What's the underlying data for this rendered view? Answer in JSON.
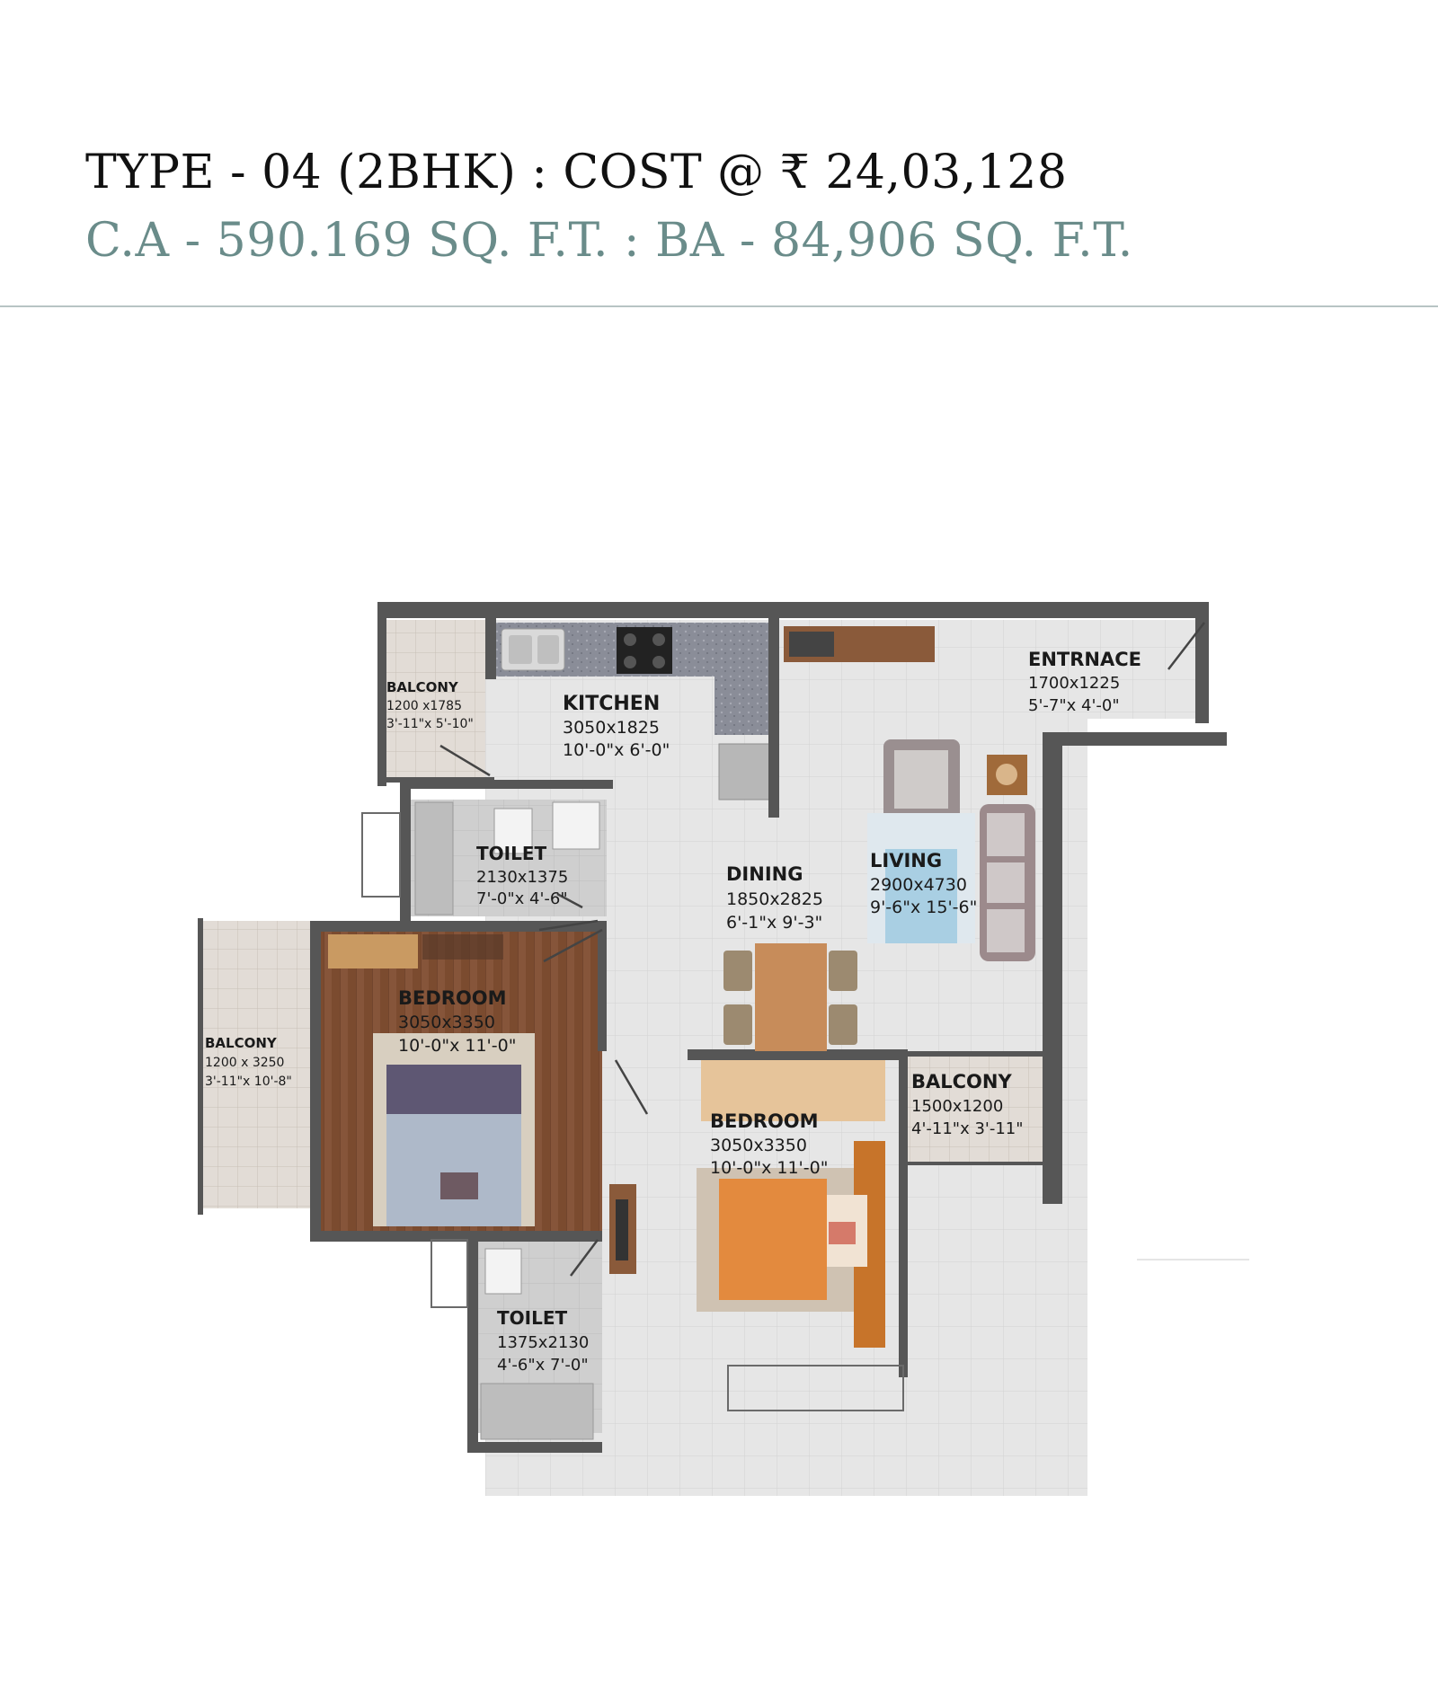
{
  "header": {
    "title": "TYPE - 04 (2BHK) : COST @ ₹ 24,03,128",
    "subtitle": "C.A - 590.169 SQ. F.T. : BA - 84,906 SQ. F.T."
  },
  "colors": {
    "title": "#111111",
    "subtitle": "#6a8c8a",
    "wall": "#555555",
    "floor_tile": "#e4e4e4",
    "wood_floor": "#7a4a2e"
  },
  "rooms": {
    "balcony_kitchen": {
      "name": "BALCONY",
      "dim1": "1200 x1785",
      "dim2": "3'-11\"x 5'-10\""
    },
    "kitchen": {
      "name": "KITCHEN",
      "dim1": "3050x1825",
      "dim2": "10'-0\"x 6'-0\""
    },
    "entrance": {
      "name": "ENTRNACE",
      "dim1": "1700x1225",
      "dim2": "5'-7\"x 4'-0\""
    },
    "toilet_top": {
      "name": "TOILET",
      "dim1": "2130x1375",
      "dim2": "7'-0\"x 4'-6\""
    },
    "dining": {
      "name": "DINING",
      "dim1": "1850x2825",
      "dim2": "6'-1\"x 9'-3\""
    },
    "living": {
      "name": "LIVING",
      "dim1": "2900x4730",
      "dim2": "9'-6\"x 15'-6\""
    },
    "bedroom_left": {
      "name": "BEDROOM",
      "dim1": "3050x3350",
      "dim2": "10'-0\"x 11'-0\""
    },
    "balcony_left": {
      "name": "BALCONY",
      "dim1": "1200 x 3250",
      "dim2": "3'-11\"x 10'-8\""
    },
    "bedroom_right": {
      "name": "BEDROOM",
      "dim1": "3050x3350",
      "dim2": "10'-0\"x 11'-0\""
    },
    "balcony_right": {
      "name": "BALCONY",
      "dim1": "1500x1200",
      "dim2": "4'-11\"x 3'-11\""
    },
    "toilet_bottom": {
      "name": "TOILET",
      "dim1": "1375x2130",
      "dim2": "4'-6\"x 7'-0\""
    }
  }
}
